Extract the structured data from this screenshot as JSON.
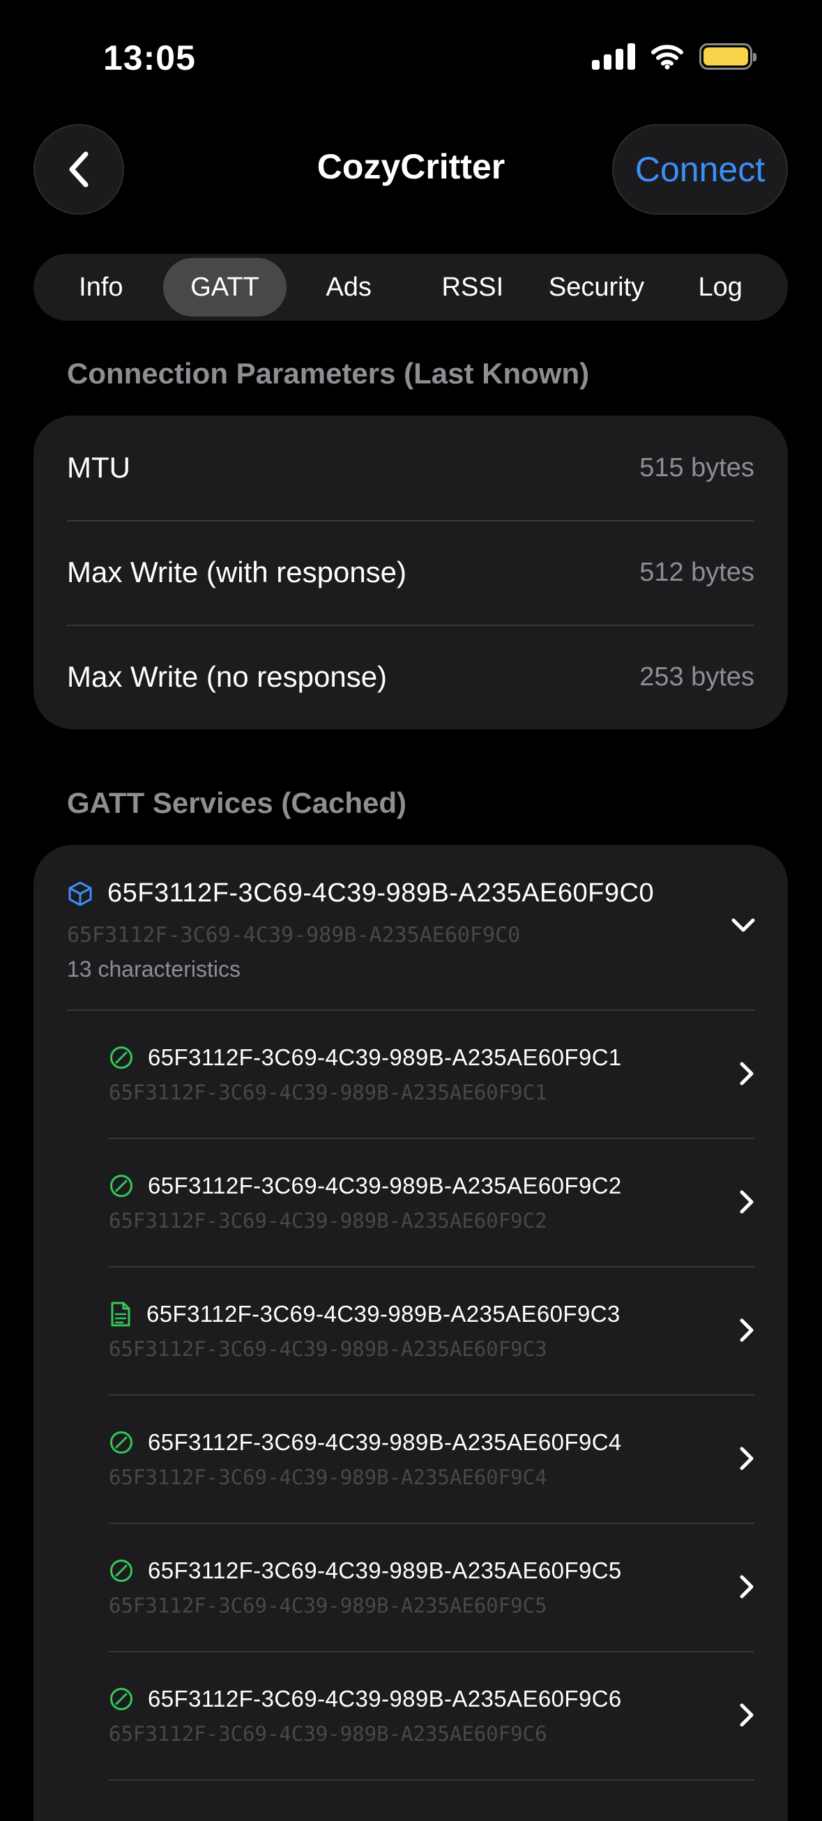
{
  "status_bar": {
    "time": "13:05",
    "icons": [
      "signal-icon",
      "wifi-icon",
      "battery-icon"
    ],
    "battery_color": "#f7d34a"
  },
  "nav": {
    "back_icon": "chevron-left-icon",
    "title": "CozyCritter",
    "connect_label": "Connect",
    "accent": "#3d8ef7"
  },
  "tabs": [
    {
      "label": "Info",
      "active": false
    },
    {
      "label": "GATT",
      "active": true
    },
    {
      "label": "Ads",
      "active": false
    },
    {
      "label": "RSSI",
      "active": false
    },
    {
      "label": "Security",
      "active": false
    },
    {
      "label": "Log",
      "active": false
    }
  ],
  "connection": {
    "header": "Connection Parameters (Last Known)",
    "rows": [
      {
        "label": "MTU",
        "value": "515 bytes"
      },
      {
        "label": "Max Write (with response)",
        "value": "512 bytes"
      },
      {
        "label": "Max Write (no response)",
        "value": "253 bytes"
      }
    ]
  },
  "services": {
    "header": "GATT Services (Cached)",
    "service": {
      "icon": "cube-icon",
      "title": "65F3112F-3C69-4C39-989B-A235AE60F9C0",
      "uuid": "65F3112F-3C69-4C39-989B-A235AE60F9C0",
      "count": "13 characteristics",
      "expanded_icon": "chevron-down-icon"
    },
    "characteristics": [
      {
        "icon": "check-circle-icon",
        "title": "65F3112F-3C69-4C39-989B-A235AE60F9C1",
        "uuid": "65F3112F-3C69-4C39-989B-A235AE60F9C1"
      },
      {
        "icon": "check-circle-icon",
        "title": "65F3112F-3C69-4C39-989B-A235AE60F9C2",
        "uuid": "65F3112F-3C69-4C39-989B-A235AE60F9C2"
      },
      {
        "icon": "document-icon",
        "title": "65F3112F-3C69-4C39-989B-A235AE60F9C3",
        "uuid": "65F3112F-3C69-4C39-989B-A235AE60F9C3"
      },
      {
        "icon": "check-circle-icon",
        "title": "65F3112F-3C69-4C39-989B-A235AE60F9C4",
        "uuid": "65F3112F-3C69-4C39-989B-A235AE60F9C4"
      },
      {
        "icon": "check-circle-icon",
        "title": "65F3112F-3C69-4C39-989B-A235AE60F9C5",
        "uuid": "65F3112F-3C69-4C39-989B-A235AE60F9C5"
      },
      {
        "icon": "check-circle-icon",
        "title": "65F3112F-3C69-4C39-989B-A235AE60F9C6",
        "uuid": "65F3112F-3C69-4C39-989B-A235AE60F9C6"
      }
    ]
  }
}
